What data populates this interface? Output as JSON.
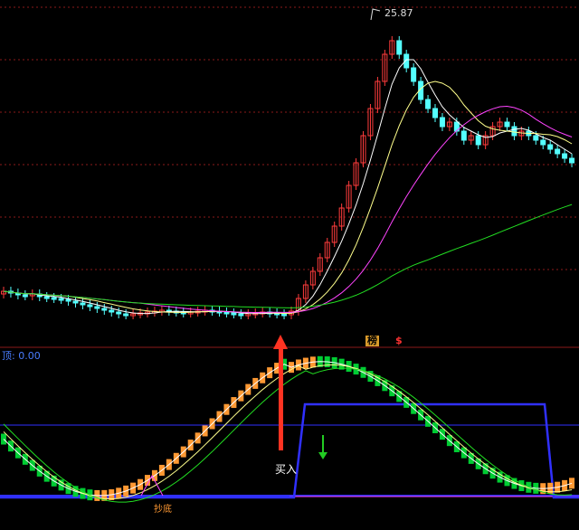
{
  "price_panel": {
    "high_label": "25.87"
  },
  "badges": {
    "rank_badge": "榜",
    "dollar_badge": "$"
  },
  "indicator_panel": {
    "header_label": "顶: 0.00",
    "buy_label": "买入",
    "bottom_label": "抄底"
  },
  "colors": {
    "background": "#000000",
    "up_candle": "#ff3c3c",
    "down_candle": "#54ffff",
    "ma_white": "#ffffff",
    "ma_yellow": "#ffff8c",
    "ma_magenta": "#ff44ff",
    "ma_green": "#22dd22",
    "grid_dashed": "#8b1a1a",
    "divider": "#8b1a1a",
    "signal_blue": "#3030ff",
    "bar_orange": "#ff9933",
    "bar_green": "#00cc33",
    "arrow_red": "#ff3322",
    "arrow_green": "#22cc22",
    "header_blue": "#4a7dff"
  }
}
